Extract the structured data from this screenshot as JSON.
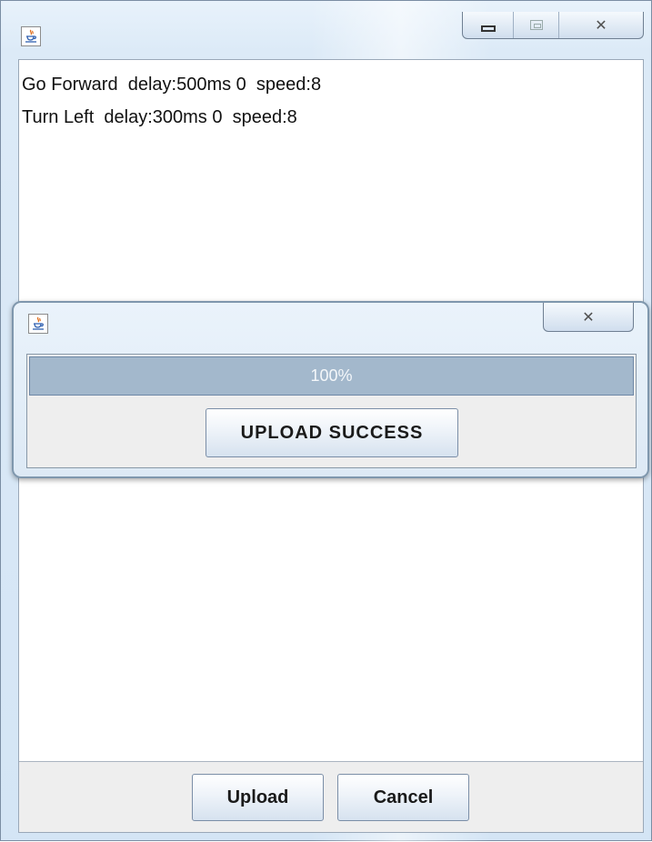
{
  "window": {
    "app_icon": "java-cup-icon",
    "controls": {
      "minimize": "minimize-icon",
      "maximize": "maximize-icon",
      "close": "✕"
    }
  },
  "list": {
    "items": [
      {
        "text": "Go Forward  delay:500ms 0  speed:8"
      },
      {
        "text": "Turn Left  delay:300ms 0  speed:8"
      }
    ]
  },
  "dialog": {
    "app_icon": "java-cup-icon",
    "close": "✕",
    "progress": {
      "value": 1.0,
      "label": "100%"
    },
    "button_label": "UPLOAD SUCCESS"
  },
  "buttons": {
    "upload": "Upload",
    "cancel": "Cancel"
  },
  "colors": {
    "progress_fill": "#a3b8cc",
    "frame": "#d4e5f5"
  }
}
